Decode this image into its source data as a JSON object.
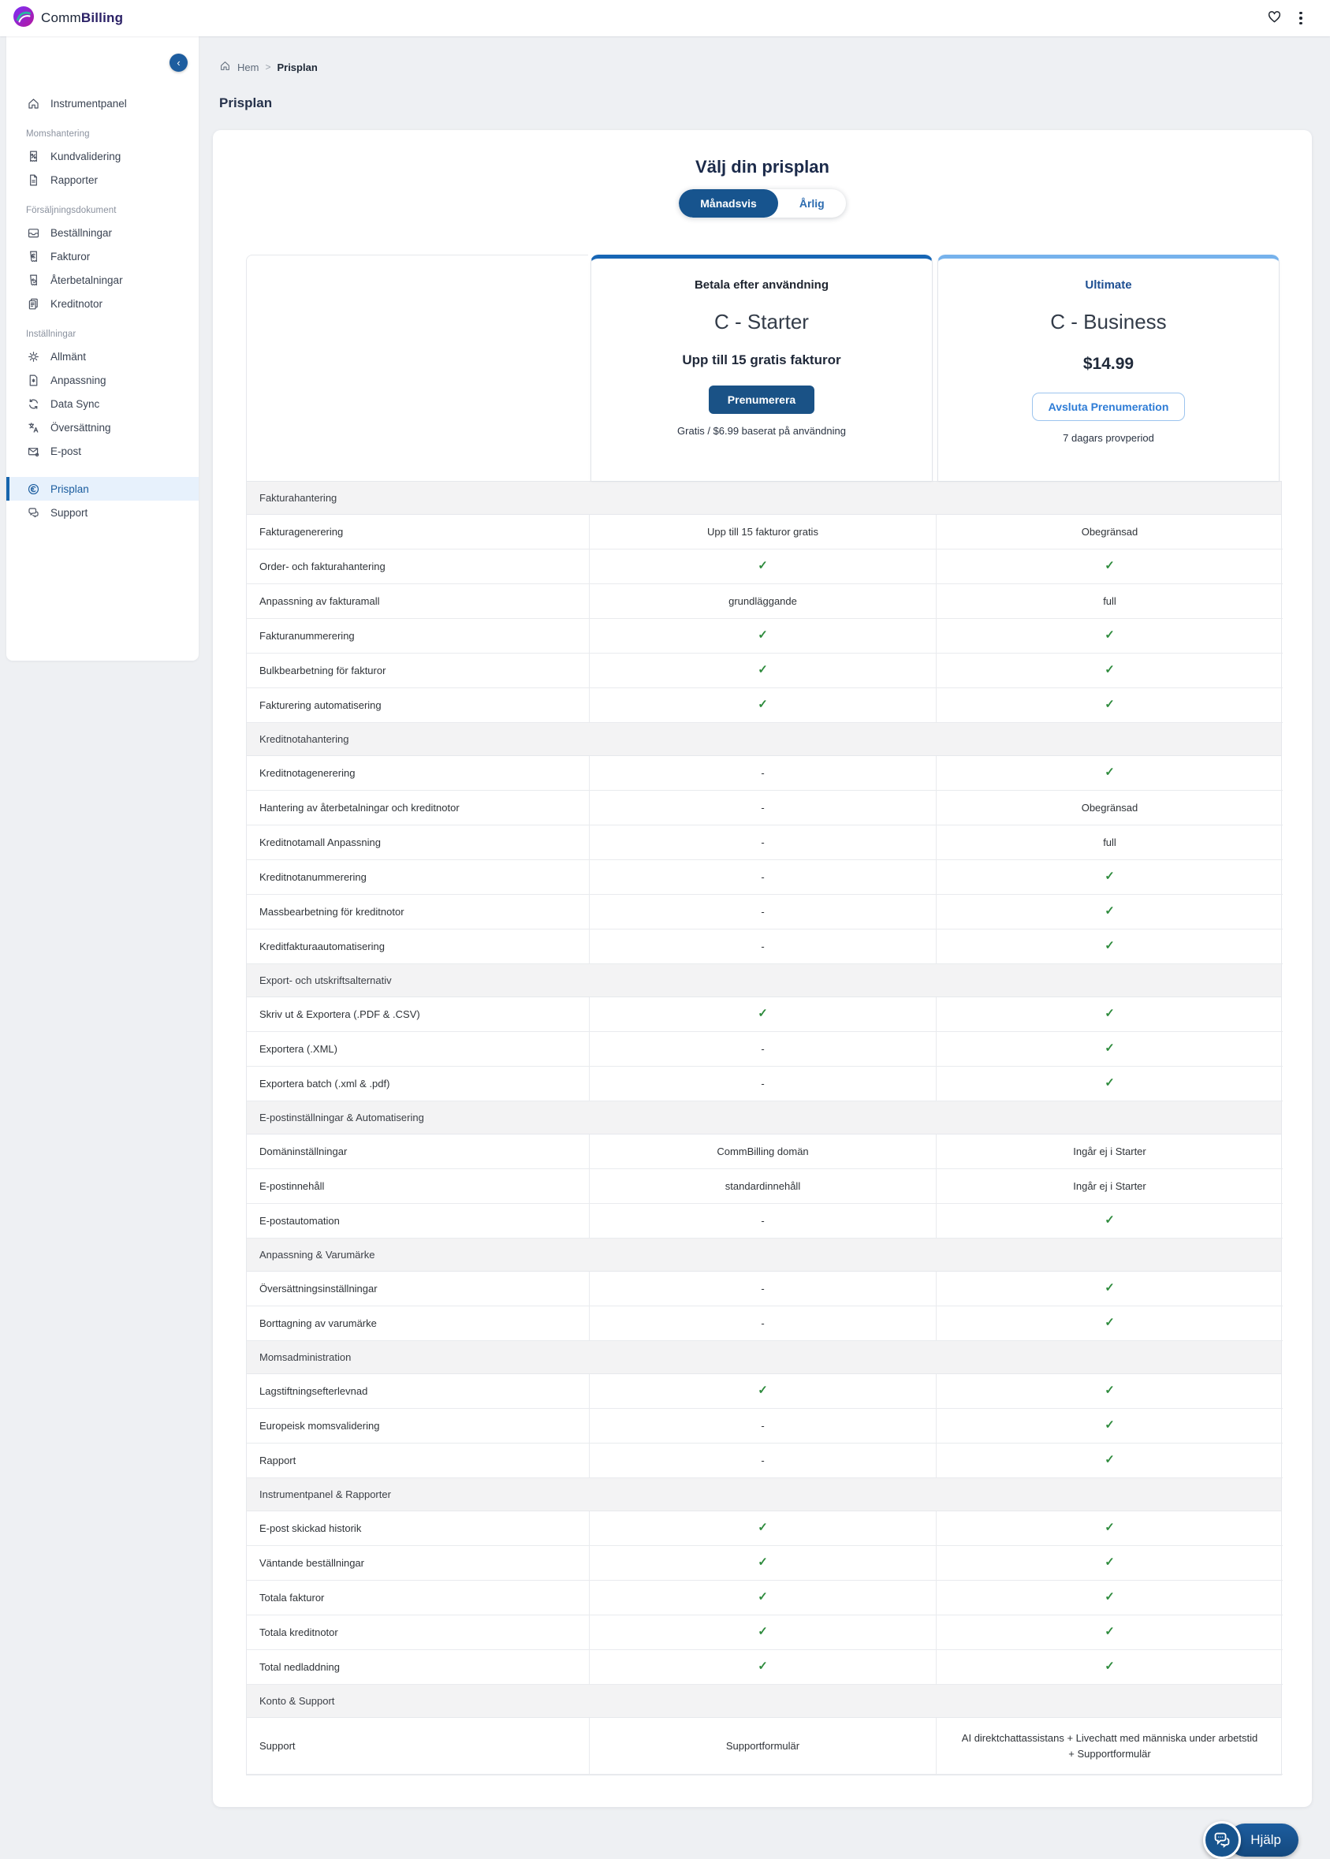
{
  "brand": {
    "comm": "Comm",
    "billing": "Billing"
  },
  "topbar": {
    "favorite_icon": "heart-icon",
    "menu_icon": "kebab-menu-icon"
  },
  "breadcrumb": {
    "home_label": "Hem",
    "separator": ">",
    "current": "Prisplan"
  },
  "page_title": "Prisplan",
  "sidebar": {
    "collapse_icon": "chevron-left-icon",
    "groups": [
      {
        "label": null,
        "items": [
          {
            "icon": "home-icon",
            "label": "Instrumentpanel",
            "active": false
          }
        ]
      },
      {
        "label": "Momshantering",
        "items": [
          {
            "icon": "receipt-percent-icon",
            "label": "Kundvalidering",
            "active": false
          },
          {
            "icon": "report-icon",
            "label": "Rapporter",
            "active": false
          }
        ]
      },
      {
        "label": "Försäljningsdokument",
        "items": [
          {
            "icon": "orders-inbox-icon",
            "label": "Beställningar",
            "active": false
          },
          {
            "icon": "invoice-euro-icon",
            "label": "Fakturor",
            "active": false
          },
          {
            "icon": "refund-receipt-icon",
            "label": "Återbetalningar",
            "active": false
          },
          {
            "icon": "credit-notes-icon",
            "label": "Kreditnotor",
            "active": false
          }
        ]
      },
      {
        "label": "Inställningar",
        "items": [
          {
            "icon": "gear-icon",
            "label": "Allmänt",
            "active": false
          },
          {
            "icon": "customization-doc-icon",
            "label": "Anpassning",
            "active": false
          },
          {
            "icon": "sync-icon",
            "label": "Data Sync",
            "active": false
          },
          {
            "icon": "translate-icon",
            "label": "Översättning",
            "active": false
          },
          {
            "icon": "email-settings-icon",
            "label": "E-post",
            "active": false
          }
        ]
      },
      {
        "label": null,
        "items": [
          {
            "icon": "euro-circle-icon",
            "label": "Prisplan",
            "active": true
          },
          {
            "icon": "support-chat-icon",
            "label": "Support",
            "active": false
          }
        ]
      }
    ]
  },
  "pricing": {
    "heading": "Välj din prisplan",
    "toggle": {
      "monthly": "Månadsvis",
      "yearly": "Årlig",
      "selected": "Månadsvis"
    }
  },
  "plans": {
    "starter": {
      "tier_label": "Betala efter användning",
      "name": "C - Starter",
      "subtitle": "Upp till 15 gratis fakturor",
      "button_label": "Prenumerera",
      "caption": "Gratis / $6.99 baserat på användning",
      "accent_color": "#1766b5"
    },
    "business": {
      "tier_label": "Ultimate",
      "name": "C - Business",
      "price": "$14.99",
      "button_label": "Avsluta Prenumeration",
      "caption": "7 dagars provperiod",
      "accent_color": "#76b2ec"
    }
  },
  "table": {
    "check_color": "#2e8b3d",
    "sections": [
      {
        "title": "Fakturahantering",
        "rows": [
          {
            "feature": "Fakturagenerering",
            "starter": "Upp till 15 fakturor gratis",
            "business": "Obegränsad"
          },
          {
            "feature": "Order- och fakturahantering",
            "starter": "check",
            "business": "check"
          },
          {
            "feature": "Anpassning av fakturamall",
            "starter": "grundläggande",
            "business": "full"
          },
          {
            "feature": "Fakturanummerering",
            "starter": "check",
            "business": "check"
          },
          {
            "feature": "Bulkbearbetning för fakturor",
            "starter": "check",
            "business": "check"
          },
          {
            "feature": "Fakturering automatisering",
            "starter": "check",
            "business": "check"
          }
        ]
      },
      {
        "title": "Kreditnotahantering",
        "rows": [
          {
            "feature": "Kreditnotagenerering",
            "starter": "-",
            "business": "check"
          },
          {
            "feature": "Hantering av återbetalningar och kreditnotor",
            "starter": "-",
            "business": "Obegränsad"
          },
          {
            "feature": "Kreditnotamall Anpassning",
            "starter": "-",
            "business": "full"
          },
          {
            "feature": "Kreditnotanummerering",
            "starter": "-",
            "business": "check"
          },
          {
            "feature": "Massbearbetning för kreditnotor",
            "starter": "-",
            "business": "check"
          },
          {
            "feature": "Kreditfakturaautomatisering",
            "starter": "-",
            "business": "check"
          }
        ]
      },
      {
        "title": "Export- och utskriftsalternativ",
        "rows": [
          {
            "feature": "Skriv ut & Exportera (.PDF & .CSV)",
            "starter": "check",
            "business": "check"
          },
          {
            "feature": "Exportera (.XML)",
            "starter": "-",
            "business": "check"
          },
          {
            "feature": "Exportera batch (.xml & .pdf)",
            "starter": "-",
            "business": "check"
          }
        ]
      },
      {
        "title": "E-postinställningar & Automatisering",
        "rows": [
          {
            "feature": "Domäninställningar",
            "starter": "CommBilling domän",
            "business": "Ingår ej i Starter"
          },
          {
            "feature": "E-postinnehåll",
            "starter": "standardinnehåll",
            "business": "Ingår ej i Starter"
          },
          {
            "feature": "E-postautomation",
            "starter": "-",
            "business": "check"
          }
        ]
      },
      {
        "title": "Anpassning & Varumärke",
        "rows": [
          {
            "feature": "Översättningsinställningar",
            "starter": "-",
            "business": "check"
          },
          {
            "feature": "Borttagning av varumärke",
            "starter": "-",
            "business": "check"
          }
        ]
      },
      {
        "title": "Momsadministration",
        "rows": [
          {
            "feature": "Lagstiftningsefterlevnad",
            "starter": "check",
            "business": "check"
          },
          {
            "feature": "Europeisk momsvalidering",
            "starter": "-",
            "business": "check"
          },
          {
            "feature": "Rapport",
            "starter": "-",
            "business": "check"
          }
        ]
      },
      {
        "title": "Instrumentpanel & Rapporter",
        "rows": [
          {
            "feature": "E-post skickad historik",
            "starter": "check",
            "business": "check"
          },
          {
            "feature": "Väntande beställningar",
            "starter": "check",
            "business": "check"
          },
          {
            "feature": "Totala fakturor",
            "starter": "check",
            "business": "check"
          },
          {
            "feature": "Totala kreditnotor",
            "starter": "check",
            "business": "check"
          },
          {
            "feature": "Total nedladdning",
            "starter": "check",
            "business": "check"
          }
        ]
      },
      {
        "title": "Konto & Support",
        "rows": [
          {
            "feature": "Support",
            "starter": "Supportformulär",
            "business": "AI direktchattassistans + Livechatt med människa under arbetstid + Supportformulär",
            "tall": true
          }
        ]
      }
    ]
  },
  "help": {
    "label": "Hjälp",
    "icon": "chat-bubbles-icon"
  }
}
